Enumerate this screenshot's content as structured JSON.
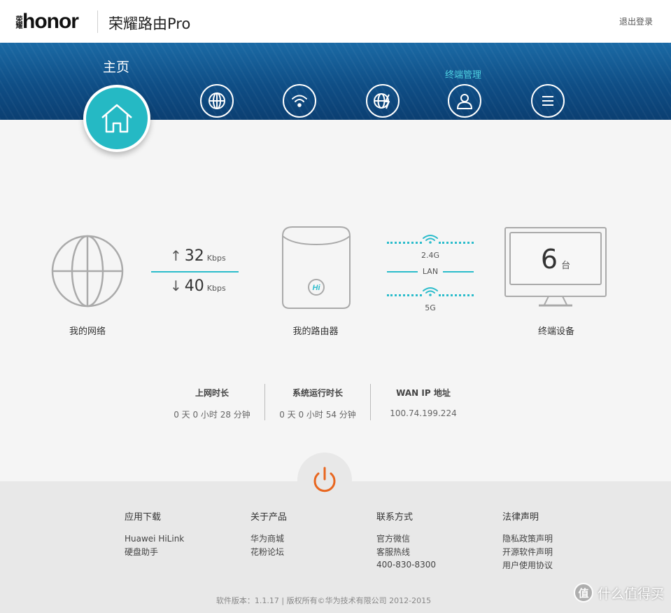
{
  "header": {
    "logo_cn": "荣耀",
    "logo_text": "honor",
    "app_title": "荣耀路由Pro",
    "logout": "退出登录"
  },
  "nav": {
    "home_label": "主页",
    "terminal_label": "终端管理",
    "items": [
      {
        "icon": "home-icon",
        "active": true
      },
      {
        "icon": "globe-icon"
      },
      {
        "icon": "wifi-icon"
      },
      {
        "icon": "globe-lightning-icon"
      },
      {
        "icon": "user-icon"
      },
      {
        "icon": "menu-icon"
      }
    ]
  },
  "diagram": {
    "network_label": "我的网络",
    "upload_value": "32",
    "upload_unit": "Kbps",
    "download_value": "40",
    "download_unit": "Kbps",
    "router_label": "我的路由器",
    "band_24": "2.4G",
    "lan": "LAN",
    "band_5": "5G",
    "device_count": "6",
    "device_unit": "台",
    "devices_label": "终端设备"
  },
  "stats": [
    {
      "title": "上网时长",
      "value": "0 天 0 小时 28 分钟"
    },
    {
      "title": "系统运行时长",
      "value": "0 天 0 小时 54 分钟"
    },
    {
      "title": "WAN IP 地址",
      "value": "100.74.199.224"
    }
  ],
  "footer": {
    "columns": [
      {
        "title": "应用下载",
        "links": [
          "Huawei HiLink",
          "硬盘助手"
        ]
      },
      {
        "title": "关于产品",
        "links": [
          "华为商城",
          "花粉论坛"
        ]
      },
      {
        "title": "联系方式",
        "links": [
          "官方微信",
          "客服热线",
          "400-830-8300"
        ]
      },
      {
        "title": "法律声明",
        "links": [
          "隐私政策声明",
          "开源软件声明",
          "用户使用协议"
        ]
      }
    ],
    "copyright": "软件版本：1.1.17  |  版权所有©华为技术有限公司 2012-2015"
  },
  "watermark": {
    "badge": "值",
    "text": "什么值得买"
  },
  "colors": {
    "accent": "#25b9c4",
    "nav_bg": "#0f4e86",
    "power": "#e8661f"
  }
}
